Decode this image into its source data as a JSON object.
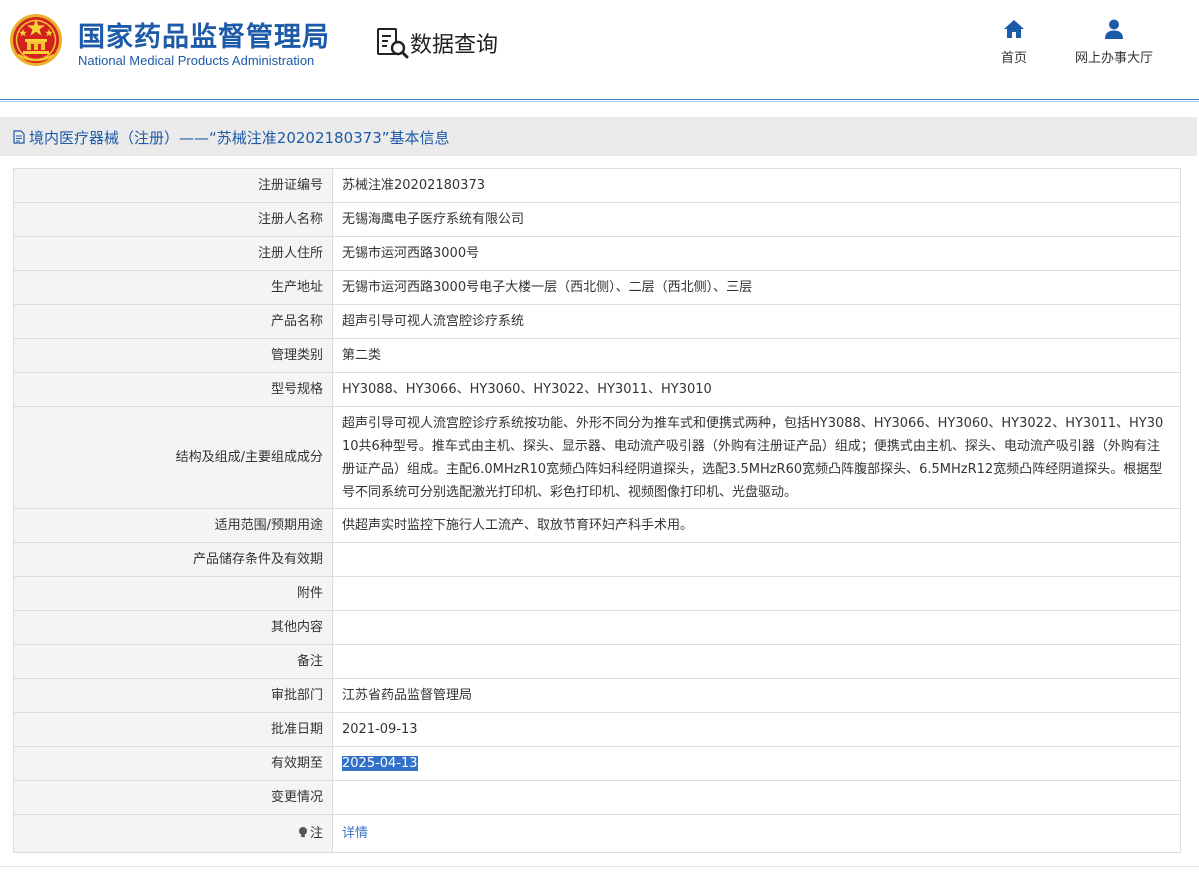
{
  "header": {
    "org_name_cn": "国家药品监督管理局",
    "org_name_en": "National Medical Products Administration",
    "query_label": "数据查询",
    "nav": [
      {
        "label": "首页",
        "icon": "home-icon"
      },
      {
        "label": "网上办事大厅",
        "icon": "user-icon"
      }
    ],
    "colors": {
      "brand": "#1d5aa8",
      "accent": "#3271c9"
    }
  },
  "section": {
    "icon": "document-icon",
    "title": "境内医疗器械（注册）——“苏械注准20202180373”基本信息"
  },
  "record": {
    "rows": [
      {
        "label": "注册证编号",
        "value": "苏械注准20202180373"
      },
      {
        "label": "注册人名称",
        "value": "无锡海鹰电子医疗系统有限公司"
      },
      {
        "label": "注册人住所",
        "value": "无锡市运河西路3000号"
      },
      {
        "label": "生产地址",
        "value": "无锡市运河西路3000号电子大楼一层（西北侧）、二层（西北侧）、三层"
      },
      {
        "label": "产品名称",
        "value": "超声引导可视人流宫腔诊疗系统"
      },
      {
        "label": "管理类别",
        "value": "第二类"
      },
      {
        "label": "型号规格",
        "value": "HY3088、HY3066、HY3060、HY3022、HY3011、HY3010"
      },
      {
        "label": "结构及组成/主要组成成分",
        "value": "超声引导可视人流宫腔诊疗系统按功能、外形不同分为推车式和便携式两种，包括HY3088、HY3066、HY3060、HY3022、HY3011、HY3010共6种型号。推车式由主机、探头、显示器、电动流产吸引器（外购有注册证产品）组成；便携式由主机、探头、电动流产吸引器（外购有注册证产品）组成。主配6.0MHzR10宽频凸阵妇科经阴道探头，选配3.5MHzR60宽频凸阵腹部探头、6.5MHzR12宽频凸阵经阴道探头。根据型号不同系统可分别选配激光打印机、彩色打印机、视频图像打印机、光盘驱动。"
      },
      {
        "label": "适用范围/预期用途",
        "value": "供超声实时监控下施行人工流产、取放节育环妇产科手术用。"
      },
      {
        "label": "产品储存条件及有效期",
        "value": ""
      },
      {
        "label": "附件",
        "value": ""
      },
      {
        "label": "其他内容",
        "value": ""
      },
      {
        "label": "备注",
        "value": ""
      },
      {
        "label": "审批部门",
        "value": "江苏省药品监督管理局"
      },
      {
        "label": "批准日期",
        "value": "2021-09-13"
      },
      {
        "label": "有效期至",
        "value": "2025-04-13"
      },
      {
        "label": "变更情况",
        "value": ""
      },
      {
        "label": "注",
        "value": "详情",
        "icon": "lightbulb-icon"
      }
    ]
  }
}
